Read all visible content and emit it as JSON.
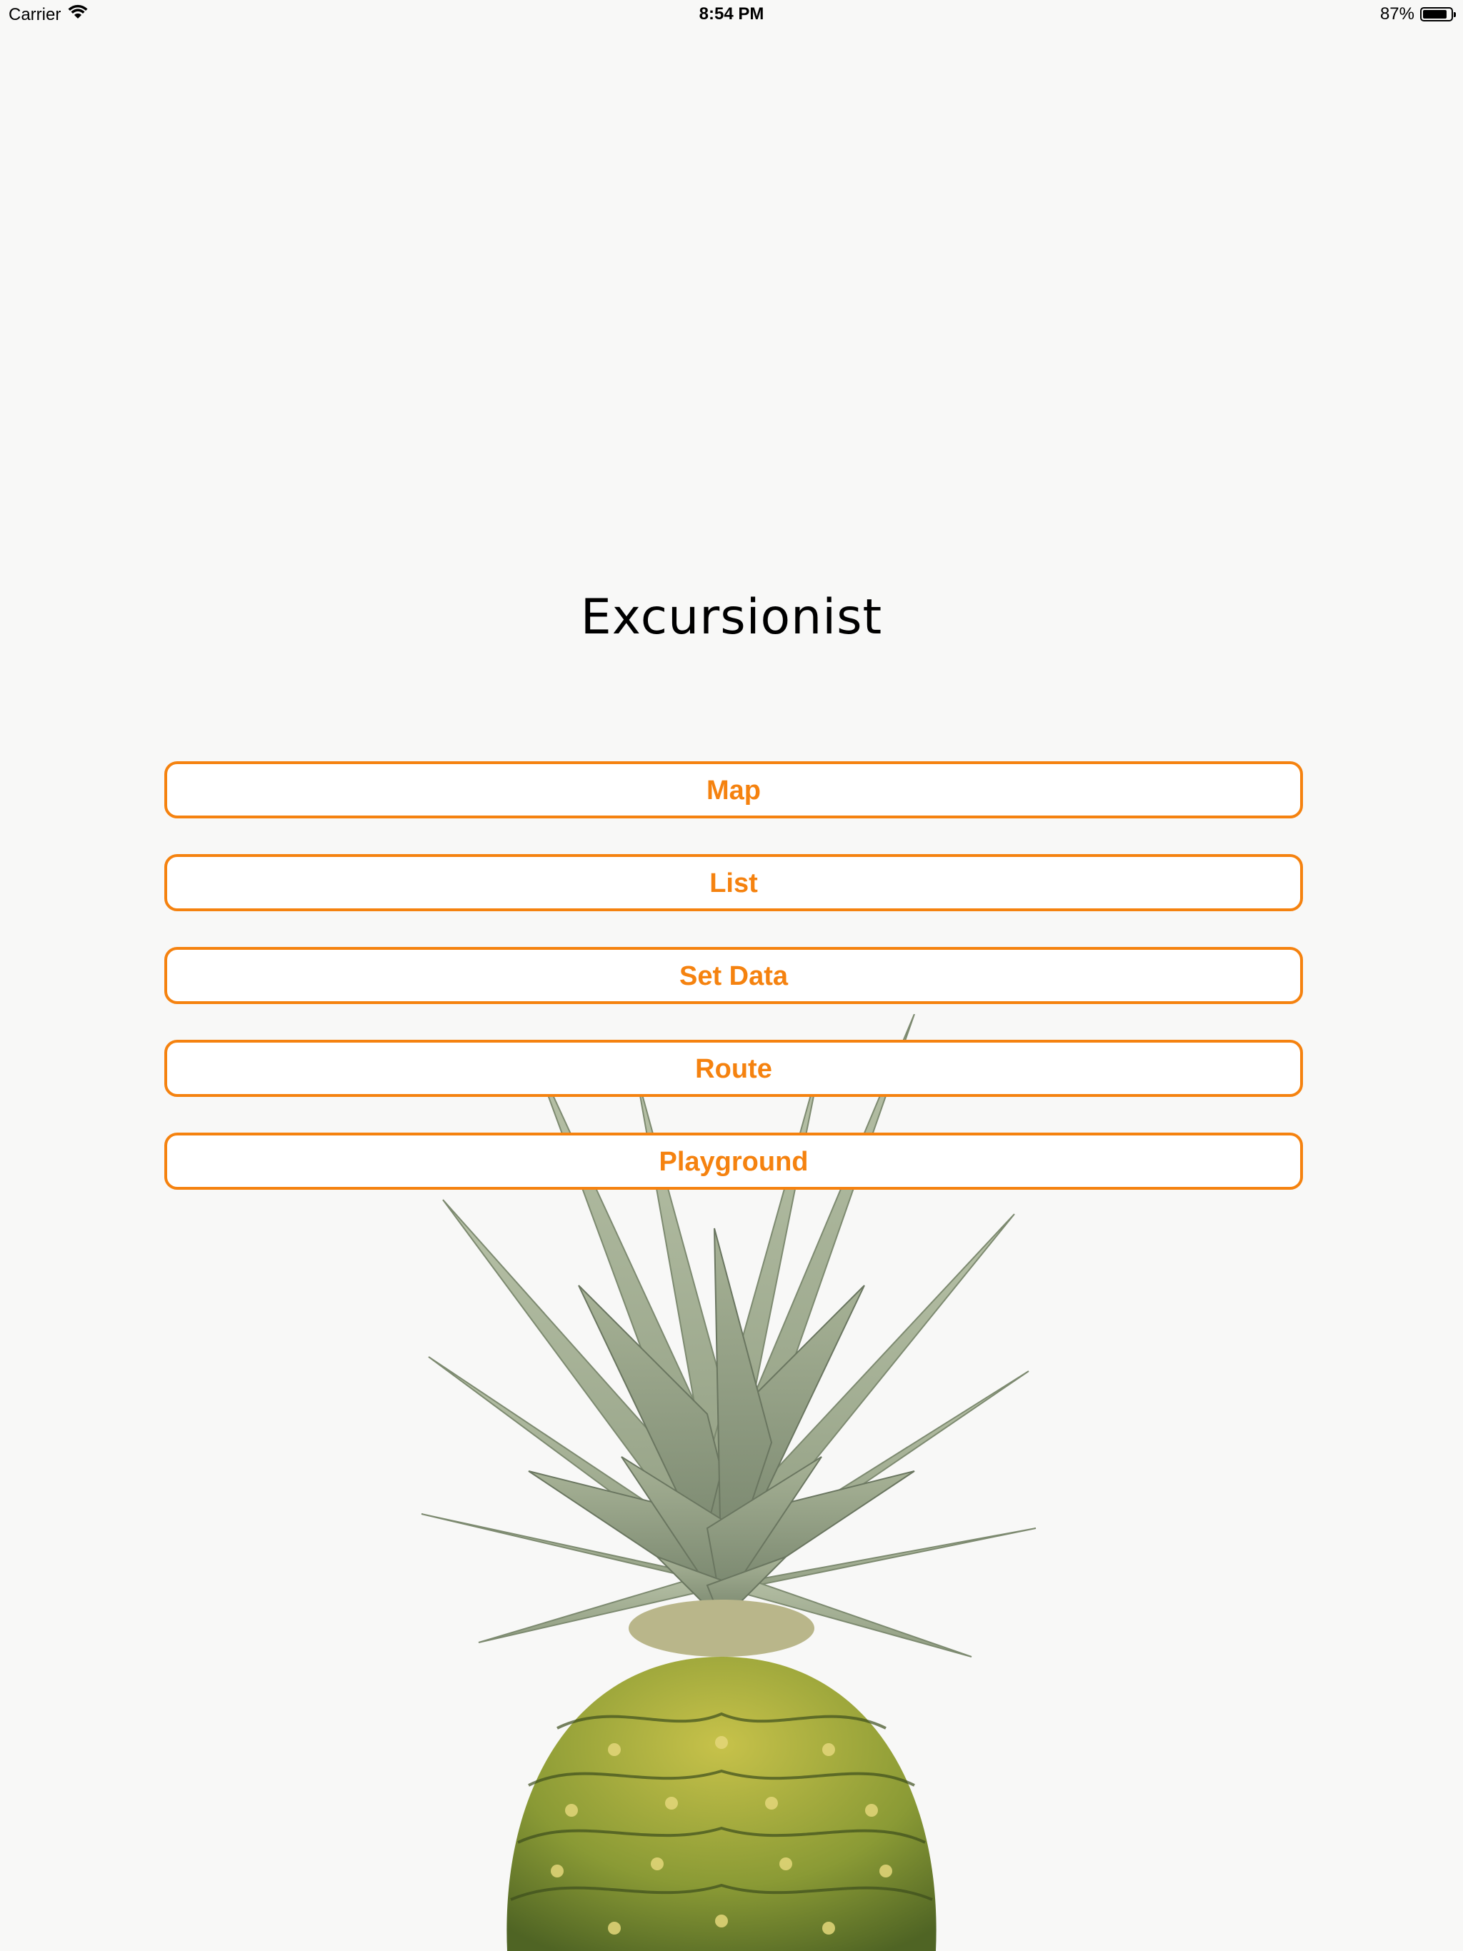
{
  "status_bar": {
    "carrier": "Carrier",
    "time": "8:54 PM",
    "battery_text": "87%",
    "battery_level": 0.87
  },
  "app": {
    "title": "Excursionist"
  },
  "menu": {
    "buttons": [
      {
        "label": "Map"
      },
      {
        "label": "List"
      },
      {
        "label": "Set Data"
      },
      {
        "label": "Route"
      },
      {
        "label": "Playground"
      }
    ]
  },
  "colors": {
    "accent": "#f5820f",
    "background": "#f8f8f7"
  },
  "icons": [
    "wifi-icon",
    "battery-icon"
  ]
}
